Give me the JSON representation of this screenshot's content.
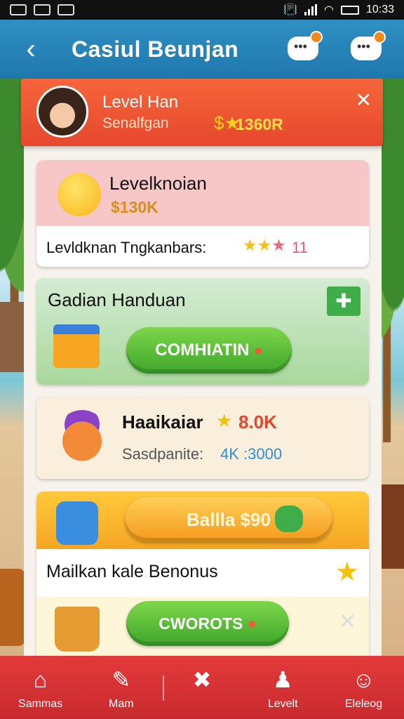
{
  "status_bar": {
    "time": "10:33"
  },
  "header": {
    "title": "Casiul Beunjan"
  },
  "level_banner": {
    "title": "Level Han",
    "subtitle": "Senalfgan",
    "value": "1360R"
  },
  "card_level": {
    "title": "Levelknoian",
    "value": "$130K",
    "row_label": "Levldknan Tngkanbars:",
    "row_value": "11"
  },
  "card_guide": {
    "title": "Gadian Handuan",
    "button_label": "COMHIATIN"
  },
  "card_hero": {
    "title": "Haaikaiar",
    "value": "8.0K",
    "sub_label": "Sasdpanite:",
    "sub_value": "4K :3000"
  },
  "card_bonus": {
    "banner_button": "Ballla $90",
    "title": "Mailkan kale Benonus",
    "button_label": "CWOROTS"
  },
  "nav": {
    "items": [
      {
        "label": "Sammas",
        "icon": "home-icon"
      },
      {
        "label": "Mam",
        "icon": "edit-icon"
      },
      {
        "label": "",
        "icon": "cross-icon"
      },
      {
        "label": "Levelt",
        "icon": "person-icon"
      },
      {
        "label": "Eleleog",
        "icon": "user-icon"
      }
    ]
  },
  "colors": {
    "header": "#1f78ad",
    "banner": "#e6472d",
    "nav": "#c92a2f",
    "green": "#3ea52b",
    "orange": "#f39a1a"
  }
}
